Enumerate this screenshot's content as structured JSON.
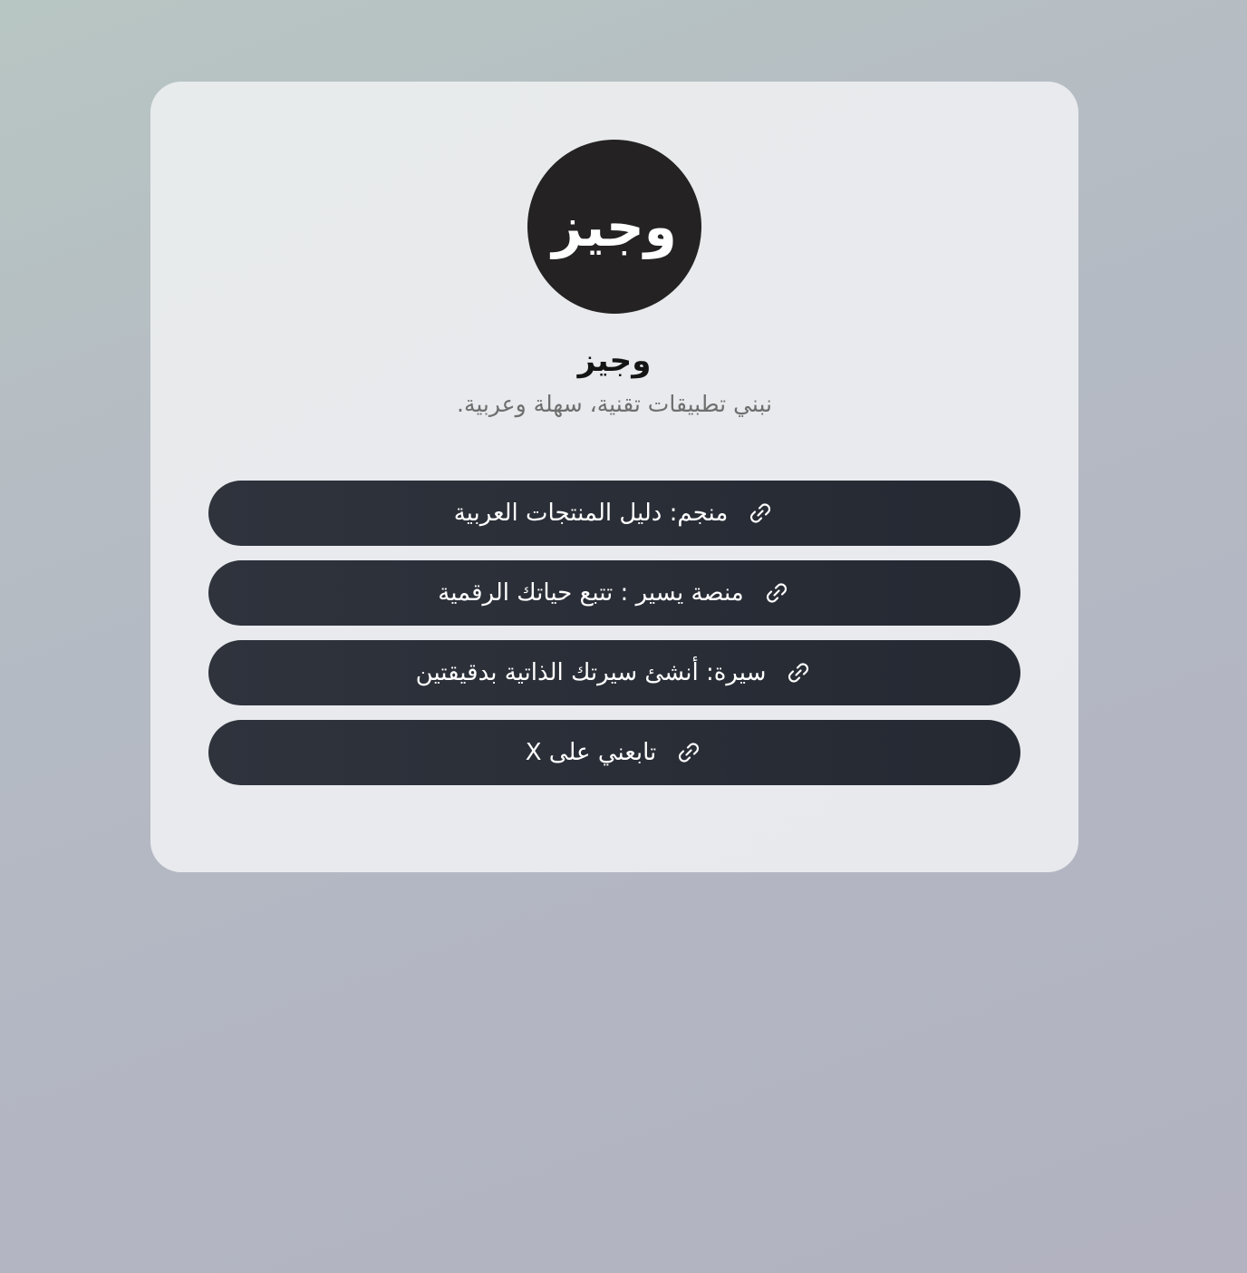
{
  "profile": {
    "avatar_text": "وجيز",
    "name": "وجيز",
    "bio": "نبني تطبيقات تقنية، سهلة وعربية."
  },
  "links": [
    {
      "label": "منجم: دليل المنتجات العربية",
      "icon": "link-icon"
    },
    {
      "label": "منصة يسير : تتبع حياتك الرقمية",
      "icon": "link-icon"
    },
    {
      "label": "سيرة: أنشئ سيرتك الذاتية بدقيقتين",
      "icon": "link-icon"
    },
    {
      "label": "تابعني على X",
      "icon": "link-icon"
    }
  ],
  "colors": {
    "avatar_bg": "#242222",
    "button_bg": "#2a2e37",
    "button_text": "#ffffff",
    "bio_text": "#6f6f6f"
  }
}
